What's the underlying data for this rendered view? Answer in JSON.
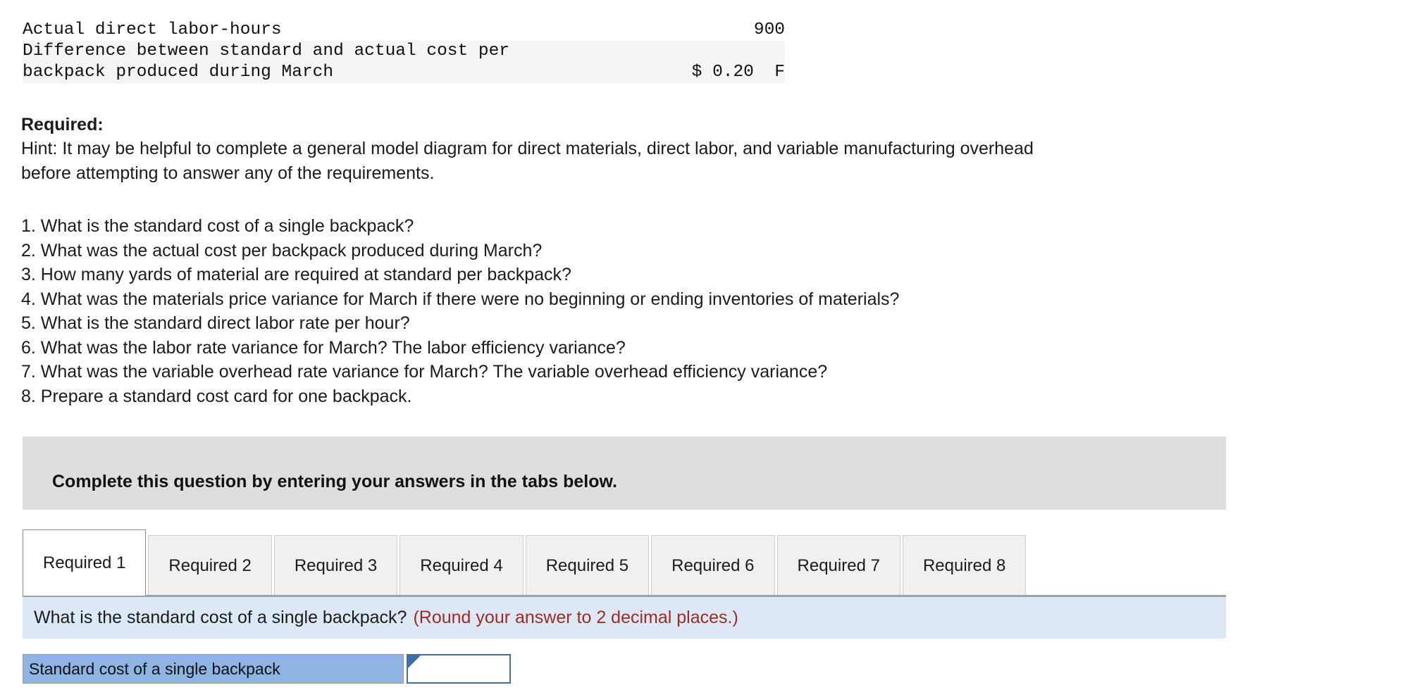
{
  "data_table": {
    "rows": [
      {
        "label": "Actual direct labor-hours",
        "label2": "",
        "value": "900",
        "shaded": false
      },
      {
        "label": "Difference between standard and actual cost per",
        "label2": "backpack produced during March",
        "value": "$ 0.20  F",
        "shaded": true
      }
    ]
  },
  "required": {
    "heading": "Required:",
    "hint_line1": "Hint:  It may be helpful to complete a general model diagram for direct materials, direct labor, and variable manufacturing overhead",
    "hint_line2": "before attempting to answer any of the requirements."
  },
  "questions": [
    "1. What is the standard cost of a single backpack?",
    "2. What was the actual cost per backpack produced during March?",
    "3. How many yards of material are required at standard per backpack?",
    "4. What was the materials price variance for March if there were no beginning or ending inventories of materials?",
    "5. What is the standard direct labor rate per hour?",
    "6. What was the labor rate variance for March? The labor efficiency variance?",
    "7. What was the variable overhead rate variance for March? The variable overhead efficiency variance?",
    "8. Prepare a standard cost card for one backpack."
  ],
  "instruction_banner": {
    "text": "Complete this question by entering your answers in the tabs below."
  },
  "tabs": [
    {
      "label": "Required 1",
      "active": true
    },
    {
      "label": "Required 2",
      "active": false
    },
    {
      "label": "Required 3",
      "active": false
    },
    {
      "label": "Required 4",
      "active": false
    },
    {
      "label": "Required 5",
      "active": false
    },
    {
      "label": "Required 6",
      "active": false
    },
    {
      "label": "Required 7",
      "active": false
    },
    {
      "label": "Required 8",
      "active": false
    }
  ],
  "question_bar": {
    "text": "What is the standard cost of a single backpack?",
    "round_note": "(Round your answer to 2 decimal places.)"
  },
  "answer_row": {
    "label": "Standard cost of a single backpack",
    "value": "",
    "placeholder": ""
  },
  "colors": {
    "banner_gray": "#dedede",
    "question_bar_blue": "#dde8f7",
    "answer_label_blue": "#8db4e2",
    "input_border_blue": "#3f6fa8",
    "note_red": "#9e2b25",
    "table_shade": "#f5f5f5"
  }
}
